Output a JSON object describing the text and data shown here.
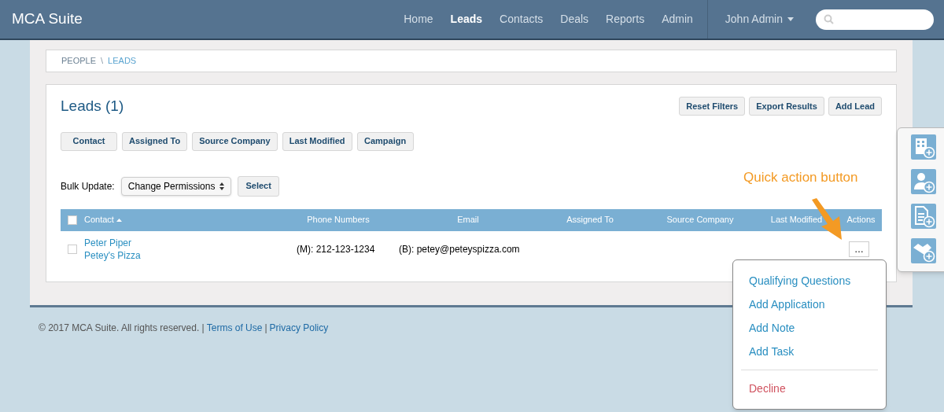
{
  "brand": "MCA Suite",
  "nav": [
    {
      "label": "Home",
      "selected": false
    },
    {
      "label": "Leads",
      "selected": true
    },
    {
      "label": "Contacts",
      "selected": false
    },
    {
      "label": "Deals",
      "selected": false
    },
    {
      "label": "Reports",
      "selected": false
    },
    {
      "label": "Admin",
      "selected": false
    }
  ],
  "user_menu": "John Admin",
  "breadcrumb": {
    "items": [
      {
        "label": "PEOPLE",
        "selected": false
      },
      {
        "label": "LEADS",
        "selected": true
      }
    ],
    "separator": "\\"
  },
  "title": "Leads (1)",
  "header_buttons": [
    "Reset Filters",
    "Export Results",
    "Add Lead"
  ],
  "filters": [
    "Contact",
    "Assigned To",
    "Source Company",
    "Last Modified",
    "Campaign"
  ],
  "bulk_update": {
    "label": "Bulk Update:",
    "value": "Change Permissions",
    "button": "Select"
  },
  "table": {
    "all_checked": false,
    "columns": [
      {
        "label": "Contact",
        "sorted": true
      },
      {
        "label": "Phone Numbers",
        "sorted": false
      },
      {
        "label": "Email",
        "sorted": false
      },
      {
        "label": "Assigned To",
        "sorted": false
      },
      {
        "label": "Source Company",
        "sorted": false
      },
      {
        "label": "Last Modified",
        "sorted": false
      },
      {
        "label": "Actions",
        "sorted": false
      }
    ],
    "rows": [
      {
        "checked": false,
        "name": "Peter Piper",
        "company": "Petey's Pizza",
        "phone": "(M): 212-123-1234",
        "email": "(B): petey@peteyspizza.com",
        "actions": "…"
      }
    ]
  },
  "annotation": "Quick action button",
  "quick_menu": [
    {
      "label": "Qualifying Questions",
      "kind": "normal"
    },
    {
      "label": "Add Application",
      "kind": "normal"
    },
    {
      "label": "Add Note",
      "kind": "normal"
    },
    {
      "label": "Add Task",
      "kind": "normal"
    },
    {
      "label": "Decline",
      "kind": "danger"
    }
  ],
  "footer": {
    "copyright": "© 2017 MCA Suite. All rights reserved. |",
    "links": [
      "Terms of Use",
      "Privacy Policy"
    ],
    "link_separator": "|"
  }
}
